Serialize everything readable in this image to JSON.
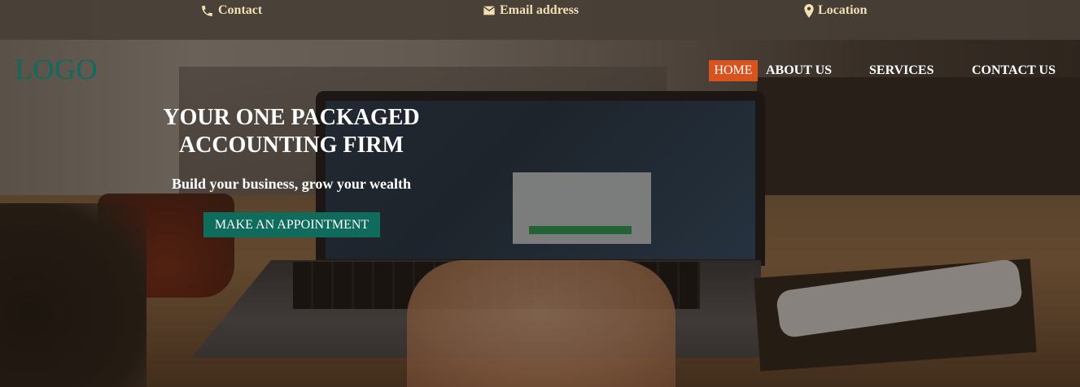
{
  "topbar": {
    "contact": {
      "label": "Contact",
      "icon": "phone-icon"
    },
    "email": {
      "label": "Email address",
      "icon": "envelope-icon"
    },
    "location": {
      "label": "Location",
      "icon": "map-pin-icon"
    }
  },
  "header": {
    "logo": "LOGO",
    "nav": [
      {
        "label": "HOME",
        "active": true
      },
      {
        "label": "ABOUT US",
        "active": false
      },
      {
        "label": "SERVICES",
        "active": false
      },
      {
        "label": "CONTACT US",
        "active": false
      }
    ]
  },
  "hero": {
    "title_line1": "YOUR ONE PACKAGED",
    "title_line2": "ACCOUNTING FIRM",
    "subtitle": "Build your business, grow your wealth",
    "cta_label": "MAKE AN APPOINTMENT"
  },
  "colors": {
    "topbar_text": "#f2dfb4",
    "logo": "#0f6b5c",
    "nav_active_bg": "#d9531e",
    "cta_bg": "#0f6b5c"
  }
}
